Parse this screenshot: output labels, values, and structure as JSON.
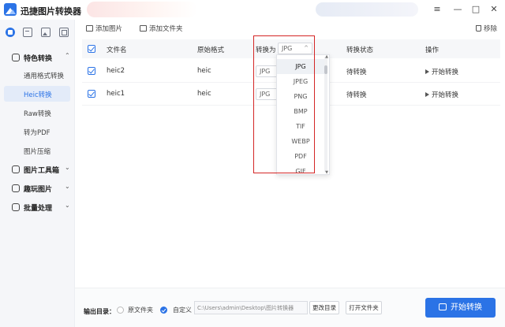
{
  "app": {
    "title": "迅捷图片转换器"
  },
  "window_controls": [
    "≡",
    "—",
    "□",
    "✕"
  ],
  "sidebar": {
    "top_icons": [
      "home-icon",
      "convert-icon",
      "image-icon",
      "copy-icon"
    ],
    "sections": [
      {
        "label": "特色转换",
        "chevron": "⌃",
        "items": [
          "通用格式转换",
          "Heic转换",
          "Raw转换",
          "转为PDF",
          "图片压缩"
        ],
        "active_item": "Heic转换"
      },
      {
        "label": "图片工具箱",
        "chevron": "⌄"
      },
      {
        "label": "趣玩图片",
        "chevron": "⌄"
      },
      {
        "label": "批量处理",
        "chevron": "⌄"
      }
    ]
  },
  "toolbar": {
    "add_image": "添加图片",
    "add_folder": "添加文件夹",
    "remove": "移除"
  },
  "table": {
    "headers": {
      "filename": "文件名",
      "original_format": "原始格式",
      "convert_to": "转换为",
      "status": "转换状态",
      "action": "操作"
    },
    "header_select_value": "JPG",
    "rows": [
      {
        "name": "heic2",
        "format": "heic",
        "target": "JPG",
        "status": "待转换",
        "action": "开始转换"
      },
      {
        "name": "heic1",
        "format": "heic",
        "target": "JPG",
        "status": "待转换",
        "action": "开始转换"
      }
    ]
  },
  "dropdown": {
    "options": [
      "JPG",
      "JPEG",
      "PNG",
      "BMP",
      "TIF",
      "WEBP",
      "PDF",
      "GIF"
    ],
    "selected": "JPG"
  },
  "footer": {
    "output_label": "输出目录：",
    "option_original": "原文件夹",
    "option_custom": "自定义",
    "path": "C:\\Users\\admin\\Desktop\\图片转换器",
    "change_dir": "更改目录",
    "open_folder": "打开文件夹",
    "start_all": "开始转换"
  },
  "colors": {
    "accent": "#2b73e6",
    "highlight_box": "#d42626",
    "sidebar_bg": "#f5f6f9"
  }
}
